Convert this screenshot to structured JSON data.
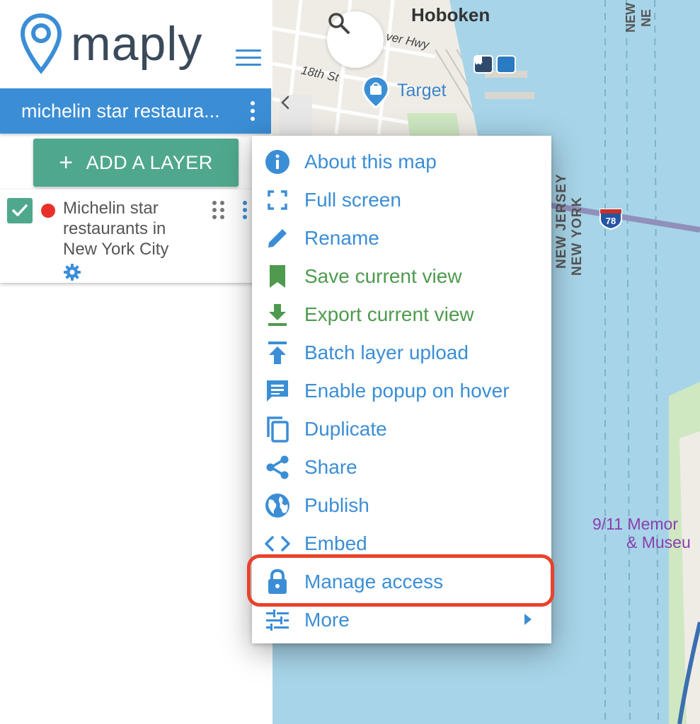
{
  "app": {
    "logo_text": "maply"
  },
  "map": {
    "labels": {
      "hoboken": "Hoboken",
      "hwy": "ver Hwy",
      "street": "18th St",
      "target": "Target",
      "nj_top": "NEW",
      "ny_top": "NE",
      "nj": "NEW JERSEY",
      "ny": "NEW YORK",
      "memorial_1": "9/11 Memor",
      "memorial_2": "& Museu"
    },
    "route_shield": "78",
    "colors": {
      "water": "#a7d4e8",
      "land": "#efece6",
      "park": "#cfe8c2",
      "route": "#8a8ab8"
    }
  },
  "sidebar": {
    "map_title": "michelin star restaura...",
    "add_layer_label": "ADD A LAYER",
    "add_layer_plus": "+",
    "layers": [
      {
        "name": "Michelin star restaurants in New York City",
        "checked": true,
        "color": "#e8312a"
      }
    ]
  },
  "menu": {
    "items": [
      {
        "label": "About this map",
        "icon": "info-icon",
        "color": "blue"
      },
      {
        "label": "Full screen",
        "icon": "fullscreen-icon",
        "color": "blue"
      },
      {
        "label": "Rename",
        "icon": "pencil-icon",
        "color": "blue"
      },
      {
        "label": "Save current view",
        "icon": "bookmark-icon",
        "color": "green"
      },
      {
        "label": "Export current view",
        "icon": "download-icon",
        "color": "green"
      },
      {
        "label": "Batch layer upload",
        "icon": "upload-icon",
        "color": "blue"
      },
      {
        "label": "Enable popup on hover",
        "icon": "comment-icon",
        "color": "blue"
      },
      {
        "label": "Duplicate",
        "icon": "copy-icon",
        "color": "blue"
      },
      {
        "label": "Share",
        "icon": "share-icon",
        "color": "blue"
      },
      {
        "label": "Publish",
        "icon": "globe-icon",
        "color": "blue"
      },
      {
        "label": "Embed",
        "icon": "code-icon",
        "color": "blue"
      },
      {
        "label": "Manage access",
        "icon": "lock-icon",
        "color": "blue",
        "highlighted": true
      },
      {
        "label": "More",
        "icon": "sliders-icon",
        "color": "blue",
        "submenu": true
      }
    ]
  },
  "colors": {
    "primary": "#3b8ed6",
    "green": "#4fa88d",
    "highlight": "#e8432c"
  }
}
